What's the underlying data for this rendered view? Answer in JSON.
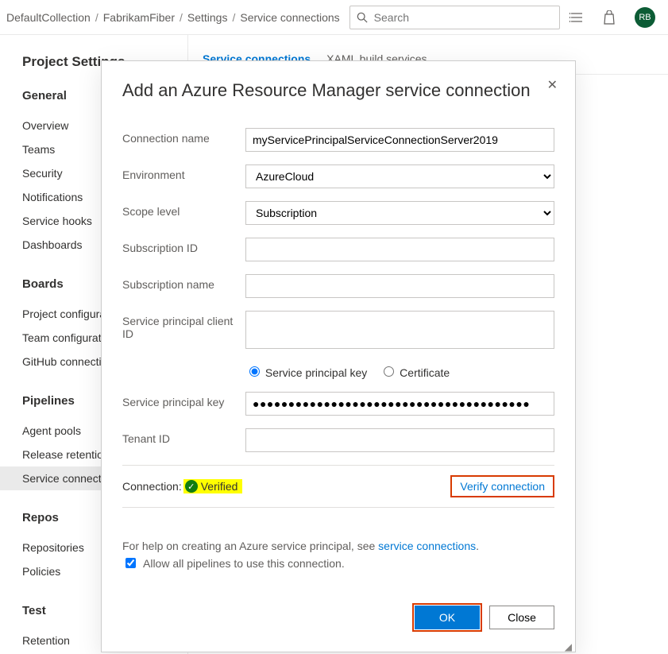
{
  "breadcrumb": [
    "DefaultCollection",
    "FabrikamFiber",
    "Settings",
    "Service connections"
  ],
  "search": {
    "placeholder": "Search"
  },
  "avatar": "RB",
  "sidebar": {
    "title": "Project Settings",
    "groups": [
      {
        "heading": "General",
        "items": [
          "Overview",
          "Teams",
          "Security",
          "Notifications",
          "Service hooks",
          "Dashboards"
        ]
      },
      {
        "heading": "Boards",
        "items": [
          "Project configuration",
          "Team configuration",
          "GitHub connections"
        ]
      },
      {
        "heading": "Pipelines",
        "items": [
          "Agent pools",
          "Release retention",
          "Service connections"
        ]
      },
      {
        "heading": "Repos",
        "items": [
          "Repositories",
          "Policies"
        ]
      },
      {
        "heading": "Test",
        "items": [
          "Retention"
        ]
      }
    ]
  },
  "tabs": {
    "active": "Service connections",
    "other": "XAML build services"
  },
  "dialog": {
    "title": "Add an Azure Resource Manager service connection",
    "labels": {
      "connName": "Connection name",
      "environment": "Environment",
      "scope": "Scope level",
      "subId": "Subscription ID",
      "subName": "Subscription name",
      "spClientId": "Service principal client ID",
      "spKey": "Service principal key",
      "tenantId": "Tenant ID",
      "radioKey": "Service principal key",
      "radioCert": "Certificate",
      "connectionLabel": "Connection:",
      "verified": "Verified",
      "verify": "Verify connection",
      "helpPrefix": "For help on creating an Azure service principal, see ",
      "helpLink": "service connections",
      "allow": "Allow all pipelines to use this connection.",
      "ok": "OK",
      "close": "Close"
    },
    "values": {
      "connName": "myServicePrincipalServiceConnectionServer2019",
      "environment": "AzureCloud",
      "scope": "Subscription",
      "spKeyValue": "●●●●●●●●●●●●●●●●●●●●●●●●●●●●●●●●●●●●●●●"
    }
  }
}
